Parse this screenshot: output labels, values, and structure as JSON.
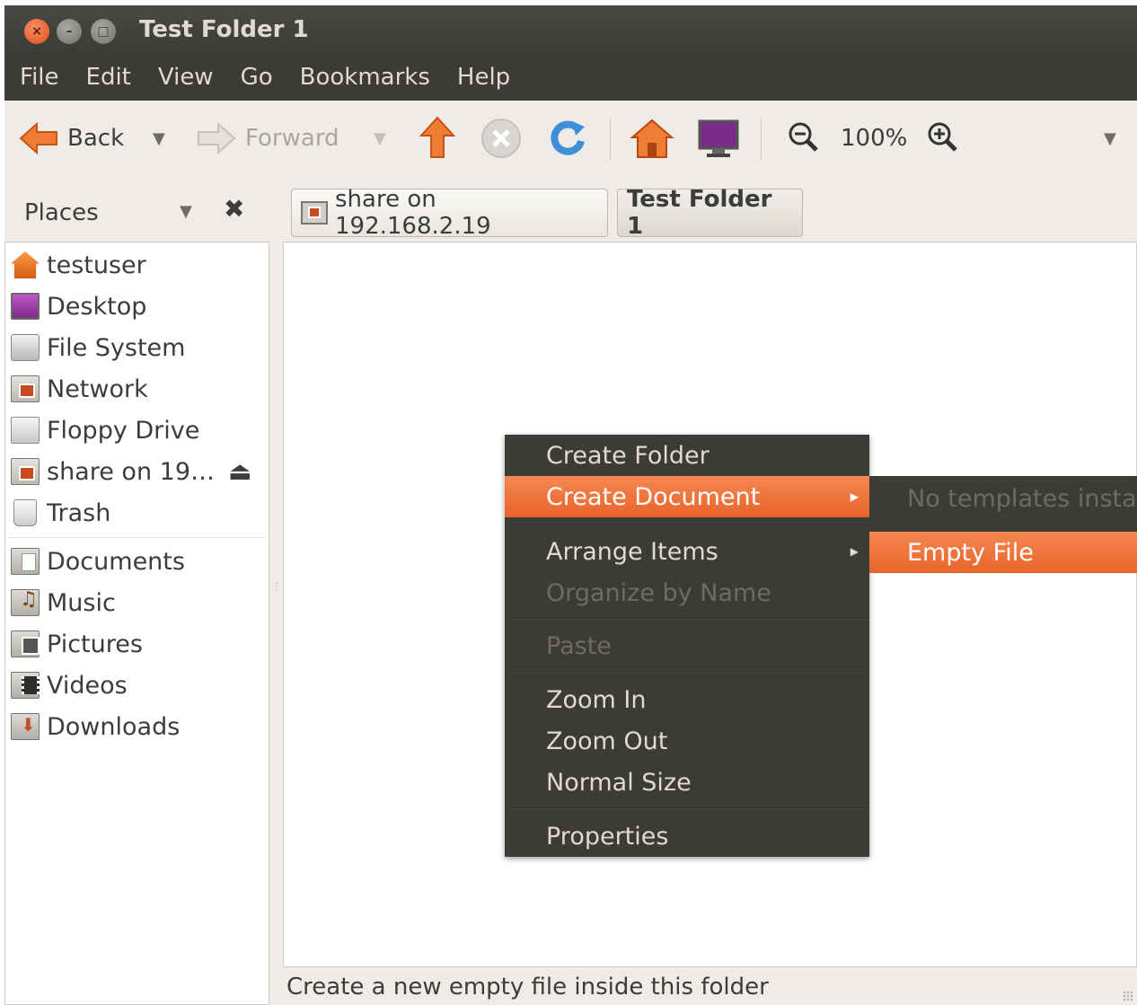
{
  "window": {
    "title": "Test Folder 1",
    "buttons": {
      "close": "×",
      "minimize": "–",
      "maximize": "□"
    }
  },
  "menubar": [
    "File",
    "Edit",
    "View",
    "Go",
    "Bookmarks",
    "Help"
  ],
  "toolbar": {
    "back_label": "Back",
    "forward_label": "Forward",
    "zoom_level": "100%"
  },
  "places": {
    "label": "Places",
    "items": [
      {
        "label": "testuser",
        "icon": "home-icon"
      },
      {
        "label": "Desktop",
        "icon": "desktop-icon"
      },
      {
        "label": "File System",
        "icon": "filesystem-icon"
      },
      {
        "label": "Network",
        "icon": "network-icon"
      },
      {
        "label": "Floppy Drive",
        "icon": "floppy-icon"
      },
      {
        "label": "share on 19…",
        "icon": "network-share-icon"
      },
      {
        "label": "Trash",
        "icon": "trash-icon"
      }
    ],
    "bookmarks": [
      {
        "label": "Documents",
        "icon": "documents-folder-icon"
      },
      {
        "label": "Music",
        "icon": "music-folder-icon"
      },
      {
        "label": "Pictures",
        "icon": "pictures-folder-icon"
      },
      {
        "label": "Videos",
        "icon": "videos-folder-icon"
      },
      {
        "label": "Downloads",
        "icon": "downloads-folder-icon"
      }
    ]
  },
  "breadcrumbs": [
    {
      "label": "share on 192.168.2.19"
    },
    {
      "label": "Test Folder 1"
    }
  ],
  "context_menu": {
    "items": [
      {
        "label": "Create Folder"
      },
      {
        "label": "Create Document"
      },
      {
        "label": "Arrange Items"
      },
      {
        "label": "Organize by Name"
      },
      {
        "label": "Paste"
      },
      {
        "label": "Zoom In"
      },
      {
        "label": "Zoom Out"
      },
      {
        "label": "Normal Size"
      },
      {
        "label": "Properties"
      }
    ],
    "submenu": [
      {
        "label": "No templates insta"
      },
      {
        "label": "Empty File"
      }
    ]
  },
  "statusbar": {
    "text": "Create a new empty file inside this folder"
  },
  "colors": {
    "accent": "#e9642a",
    "titlebar": "#3c3b37",
    "menu_bg": "#3c3b37",
    "window_bg": "#efebe7"
  }
}
